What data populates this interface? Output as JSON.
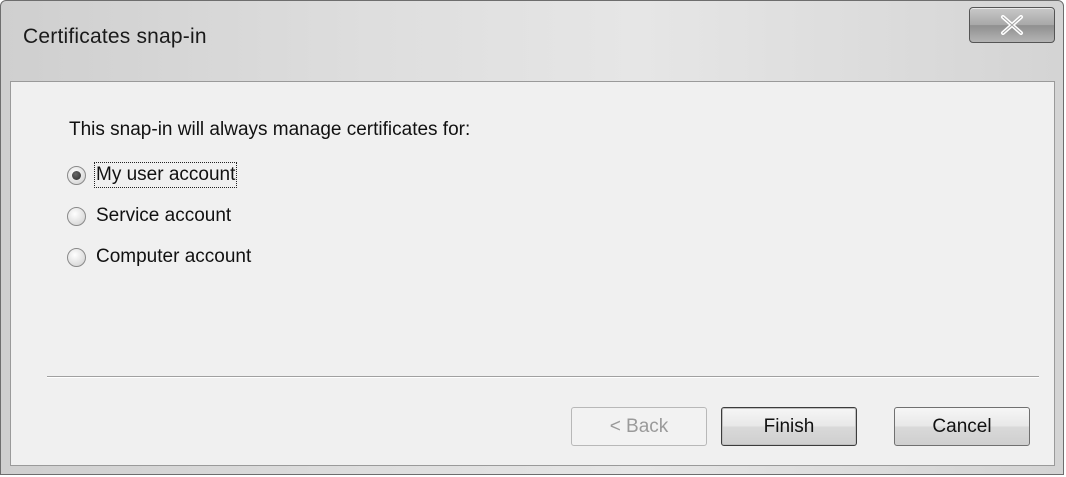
{
  "window": {
    "title": "Certificates snap-in"
  },
  "content": {
    "prompt": "This snap-in will always manage certificates for:",
    "options": [
      {
        "label": "My user account",
        "checked": true
      },
      {
        "label": "Service account",
        "checked": false
      },
      {
        "label": "Computer account",
        "checked": false
      }
    ]
  },
  "buttons": {
    "back_label": "< Back",
    "finish_label": "Finish",
    "cancel_label": "Cancel"
  }
}
